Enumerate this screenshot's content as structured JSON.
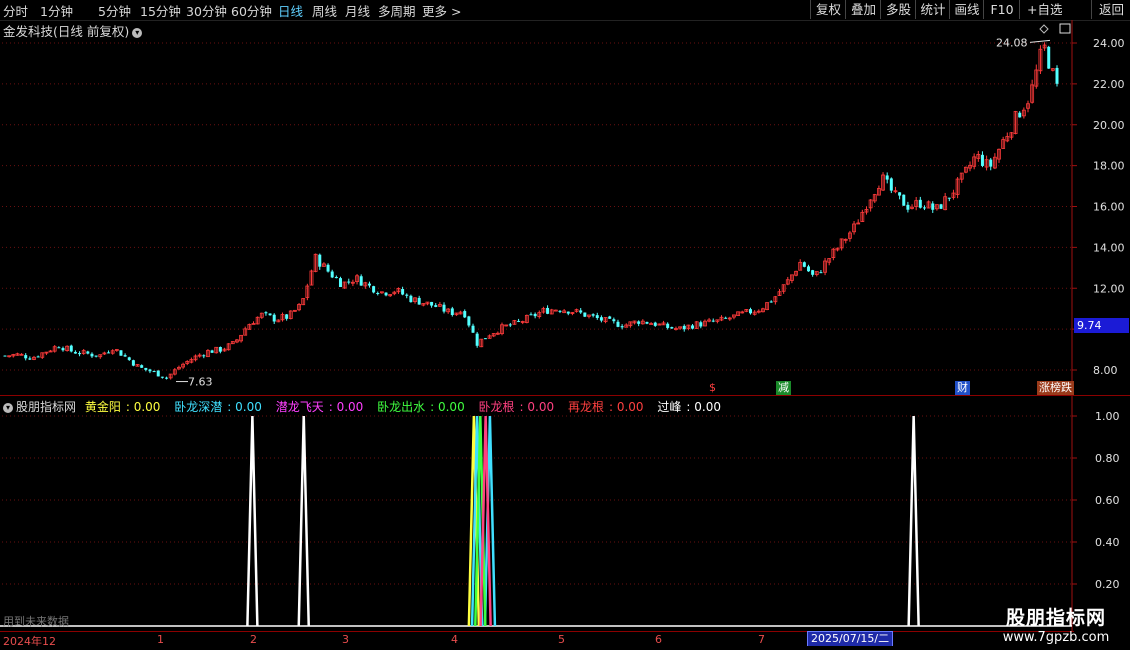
{
  "toolbar": {
    "periods": [
      "分时",
      "1分钟",
      "5分钟",
      "15分钟",
      "30分钟",
      "60分钟",
      "日线",
      "周线",
      "月线",
      "多周期",
      "更多 >"
    ],
    "active_period": "日线",
    "tools": [
      "复权",
      "叠加",
      "多股",
      "统计",
      "画线",
      "F10",
      "+自选",
      "返回"
    ]
  },
  "main_chart": {
    "title": "金发科技(日线 前复权)",
    "current_price_label": "9.74",
    "high_label": "24.08",
    "low_label": "7.63",
    "y_ticks": [
      "24.00",
      "22.00",
      "20.00",
      "18.00",
      "16.00",
      "14.00",
      "12.00",
      "10.00",
      "8.00"
    ],
    "markers": [
      {
        "text": "$",
        "color": "#ff4040",
        "bg": "none"
      },
      {
        "text": "减",
        "color": "#fff",
        "bg": "#1a8a2a"
      },
      {
        "text": "财",
        "color": "#fff",
        "bg": "#2150c8"
      },
      {
        "text": "涨榜跌",
        "color": "#fff",
        "bg": "#9a3a1a"
      }
    ]
  },
  "indicator": {
    "name": "股朋指标网",
    "series": [
      {
        "name": "黄金阳",
        "value": "0.00",
        "color": "#ffff40"
      },
      {
        "name": "卧龙深潜",
        "value": "0.00",
        "color": "#40e0ff"
      },
      {
        "name": "潜龙飞天",
        "value": "0.00",
        "color": "#ff40ff"
      },
      {
        "name": "卧龙出水",
        "value": "0.00",
        "color": "#40ff40"
      },
      {
        "name": "卧龙根",
        "value": "0.00",
        "color": "#ff4080"
      },
      {
        "name": "再龙根",
        "value": "0.00",
        "color": "#ff4040"
      },
      {
        "name": "过峰",
        "value": "0.00",
        "color": "#ffffff"
      }
    ],
    "y_ticks": [
      "1.00",
      "0.80",
      "0.60",
      "0.40",
      "0.20"
    ]
  },
  "date_axis": {
    "labels": [
      "2024年12",
      "1",
      "2",
      "3",
      "4",
      "5",
      "6",
      "7"
    ],
    "cursor_date": "2025/07/15/二"
  },
  "notice": "用到未来数据",
  "watermark": {
    "title": "股朋指标网",
    "url": "www.7gpzb.com"
  },
  "chart_data": [
    {
      "type": "candlestick",
      "title": "金发科技(日线 前复权)",
      "ylim": [
        7.2,
        25.2
      ],
      "y_ticks": [
        8,
        10,
        12,
        14,
        16,
        18,
        20,
        22,
        24
      ],
      "annotations": {
        "high": 24.08,
        "low": 7.63,
        "last": 9.74
      },
      "close_path": [
        8.7,
        8.75,
        8.6,
        8.9,
        9.2,
        8.9,
        8.8,
        8.7,
        9.1,
        8.6,
        8.1,
        7.9,
        7.63,
        8.2,
        8.6,
        8.9,
        9.0,
        9.3,
        10.2,
        10.7,
        10.5,
        10.6,
        11.2,
        13.5,
        12.8,
        12.2,
        12.5,
        12.1,
        11.8,
        11.9,
        11.5,
        11.3,
        11.1,
        10.8,
        10.9,
        9.3,
        9.8,
        10.1,
        10.3,
        10.6,
        10.9,
        11.0,
        10.9,
        10.7,
        10.5,
        10.3,
        10.2,
        10.4,
        10.3,
        10.1,
        10.0,
        10.2,
        10.3,
        10.4,
        10.6,
        10.8,
        11.0,
        11.5,
        12.3,
        13.3,
        12.5,
        13.4,
        14.2,
        15.0,
        16.3,
        17.4,
        16.5,
        16.0,
        16.2,
        15.8,
        16.5,
        17.4,
        18.5,
        17.9,
        19.2,
        20.4,
        21.4,
        23.9,
        21.8
      ]
    },
    {
      "type": "line",
      "title": "股朋指标网",
      "ylim": [
        0,
        1.05
      ],
      "y_ticks": [
        0.2,
        0.4,
        0.6,
        0.8,
        1.0
      ],
      "series": [
        {
          "name": "过峰",
          "color": "#ffffff",
          "spikes": [
            0.234,
            0.282,
            0.852
          ]
        },
        {
          "name": "黄金阳",
          "color": "#ffff40",
          "spikes": [
            0.441
          ]
        },
        {
          "name": "卧龙深潜",
          "color": "#40e0ff",
          "spikes": [
            0.444,
            0.456
          ]
        },
        {
          "name": "卧龙出水",
          "color": "#40ff40",
          "spikes": [
            0.447
          ]
        },
        {
          "name": "卧龙根",
          "color": "#ff4080",
          "spikes": [
            0.452
          ]
        }
      ]
    }
  ]
}
